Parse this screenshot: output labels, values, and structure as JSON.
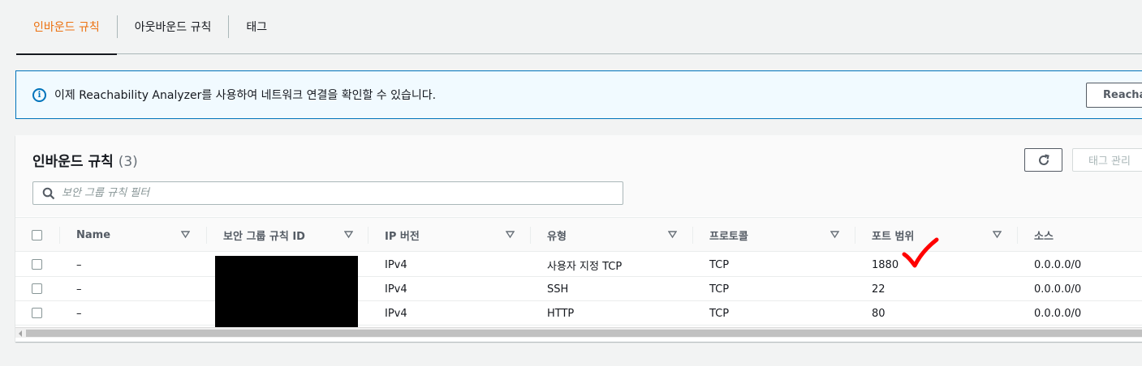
{
  "tabs": [
    {
      "label": "인바운드 규칙",
      "active": true
    },
    {
      "label": "아웃바운드 규칙",
      "active": false
    },
    {
      "label": "태그",
      "active": false
    }
  ],
  "banner": {
    "text": "이제 Reachability Analyzer를 사용하여 네트워크 연결을 확인할 수 있습니다.",
    "button_label": "Reacha",
    "icon": "info-icon"
  },
  "panel": {
    "title": "인바운드 규칙",
    "count": "(3)",
    "refresh_icon": "refresh-icon",
    "tag_button_label": "태그 관리",
    "filter_placeholder": "보안 그룹 규칙 필터"
  },
  "table": {
    "columns": [
      "Name",
      "보안 그룹 규칙 ID",
      "IP 버전",
      "유형",
      "프로토콜",
      "포트 범위",
      "소스"
    ],
    "rows": [
      {
        "name": "–",
        "rule_id": "",
        "ip_version": "IPv4",
        "type": "사용자 지정 TCP",
        "protocol": "TCP",
        "port_range": "1880",
        "source": "0.0.0.0/0"
      },
      {
        "name": "–",
        "rule_id": "",
        "ip_version": "IPv4",
        "type": "SSH",
        "protocol": "TCP",
        "port_range": "22",
        "source": "0.0.0.0/0"
      },
      {
        "name": "–",
        "rule_id": "",
        "ip_version": "IPv4",
        "type": "HTTP",
        "protocol": "TCP",
        "port_range": "80",
        "source": "0.0.0.0/0"
      }
    ]
  },
  "colors": {
    "accent": "#ec7211",
    "info_blue": "#0073bb",
    "annotation_red": "#ff0000"
  }
}
